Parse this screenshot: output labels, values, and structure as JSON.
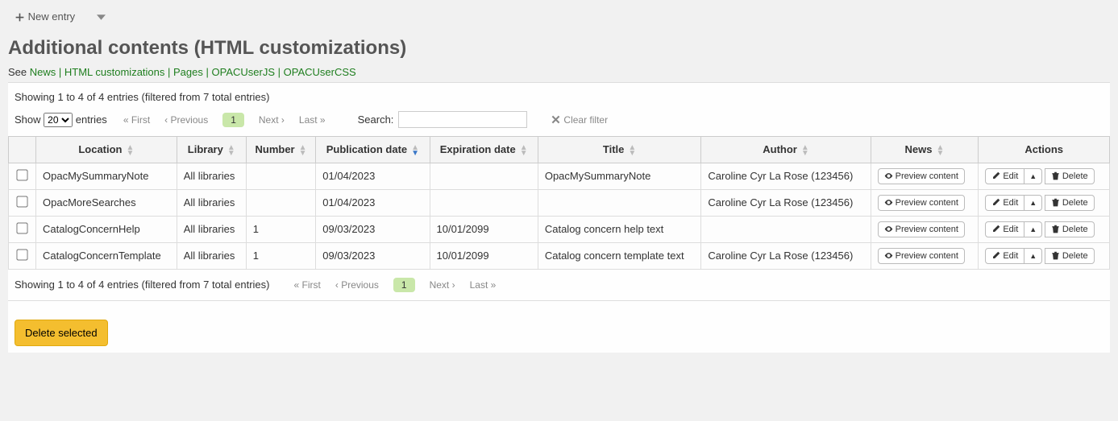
{
  "toolbar": {
    "new_entry_label": "New entry"
  },
  "page_title": "Additional contents (HTML customizations)",
  "see_line": {
    "prefix": "See ",
    "links": [
      "News",
      "HTML customizations",
      "Pages",
      "OPACUserJS",
      "OPACUserCSS"
    ]
  },
  "info_top": "Showing 1 to 4 of 4 entries (filtered from 7 total entries)",
  "show_entries": {
    "prefix": "Show",
    "value": "20",
    "suffix": "entries"
  },
  "pager": {
    "first": "First",
    "prev": "Previous",
    "current": "1",
    "next": "Next",
    "last": "Last"
  },
  "search": {
    "label": "Search:",
    "value": ""
  },
  "clear_filter_label": "Clear filter",
  "columns": {
    "location": "Location",
    "library": "Library",
    "number": "Number",
    "pub_date": "Publication date",
    "exp_date": "Expiration date",
    "title": "Title",
    "author": "Author",
    "news": "News",
    "actions": "Actions"
  },
  "action_labels": {
    "preview": "Preview content",
    "edit": "Edit",
    "delete": "Delete"
  },
  "rows": [
    {
      "location": "OpacMySummaryNote",
      "library": "All libraries",
      "number": "",
      "pub_date": "01/04/2023",
      "exp_date": "",
      "title": "OpacMySummaryNote",
      "author": "Caroline Cyr La Rose (123456)"
    },
    {
      "location": "OpacMoreSearches",
      "library": "All libraries",
      "number": "",
      "pub_date": "01/04/2023",
      "exp_date": "",
      "title": "",
      "author": "Caroline Cyr La Rose (123456)"
    },
    {
      "location": "CatalogConcernHelp",
      "library": "All libraries",
      "number": "1",
      "pub_date": "09/03/2023",
      "exp_date": "10/01/2099",
      "title": "Catalog concern help text",
      "author": ""
    },
    {
      "location": "CatalogConcernTemplate",
      "library": "All libraries",
      "number": "1",
      "pub_date": "09/03/2023",
      "exp_date": "10/01/2099",
      "title": "Catalog concern template text",
      "author": "Caroline Cyr La Rose (123456)"
    }
  ],
  "info_bottom": "Showing 1 to 4 of 4 entries (filtered from 7 total entries)",
  "delete_selected_label": "Delete selected"
}
